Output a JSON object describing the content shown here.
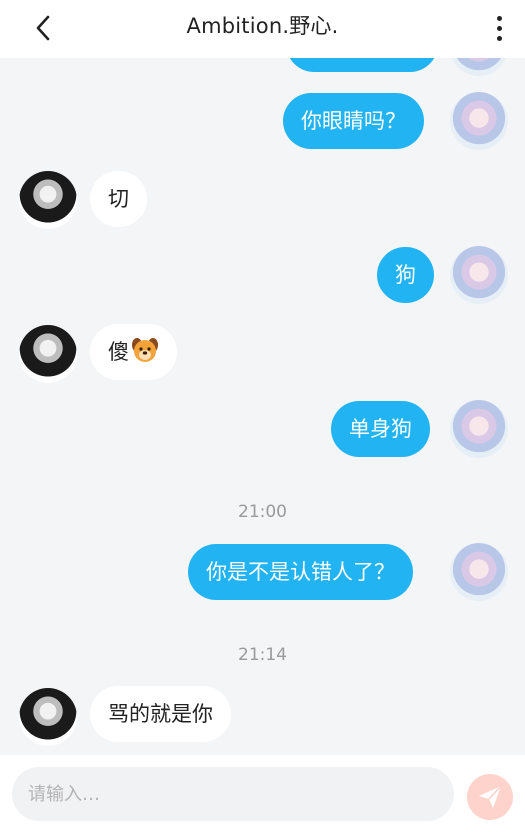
{
  "header": {
    "title": "Ambition.野心."
  },
  "messages": [
    {
      "side": "out",
      "text": "你眼睛吗？"
    },
    {
      "side": "in",
      "text": "切"
    },
    {
      "side": "out",
      "text": "狗"
    },
    {
      "side": "in",
      "text": "傻"
    },
    {
      "side": "out",
      "text": "单身狗"
    },
    {
      "time": "21:00"
    },
    {
      "side": "out",
      "text": "你是不是认错人了？"
    },
    {
      "time": "21:14"
    },
    {
      "side": "in",
      "text": "骂的就是你"
    }
  ],
  "input": {
    "placeholder": "请输入…",
    "value": ""
  },
  "icons": {
    "back": "back-chevron-icon",
    "more": "more-vertical-icon",
    "send": "send-paper-plane-icon",
    "dog": "dog-face-emoji-icon"
  },
  "colors": {
    "outgoing_bubble": "#22b3f3",
    "incoming_bubble": "#ffffff",
    "background": "#f4f5f7",
    "send_button": "#fdd3cc"
  }
}
